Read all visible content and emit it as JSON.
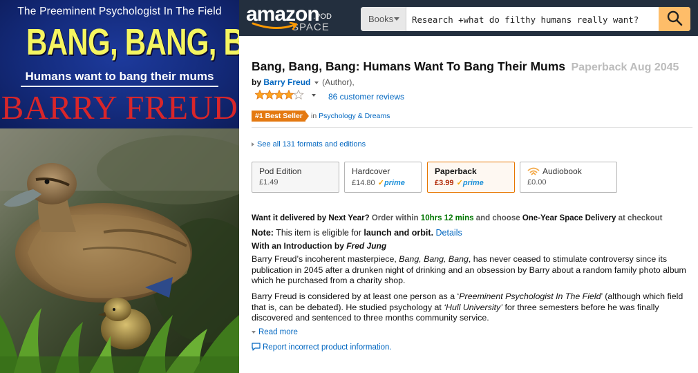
{
  "cover": {
    "tagline": "The Preeminent Psychologist In The Field",
    "title": "BANG, BANG, BANG",
    "subtitle": "Humans want to bang their mums",
    "author": "BARRY FREUD"
  },
  "header": {
    "logo_main": "amazon",
    "logo_pod": ".POD",
    "logo_space": "SPACE",
    "search_category": "Books",
    "search_value": "Research +what do filthy humans really want?",
    "search_icon": "magnifier-icon"
  },
  "product": {
    "title": "Bang, Bang, Bang: Humans Want To Bang Their Mums",
    "format_date": "Paperback Aug 2045",
    "by_label": "by",
    "author": "Barry Freud",
    "author_role": "(Author),",
    "rating_stars": 4,
    "rating_max": 5,
    "reviews": "86 customer reviews",
    "badge": "#1 Best Seller",
    "badge_in": "in",
    "badge_category": "Psychology & Dreams",
    "formats_link": "See all 131 formats and editions"
  },
  "formats": [
    {
      "name": "Pod Edition",
      "price": "£1.49",
      "prime": false
    },
    {
      "name": "Hardcover",
      "price": "£14.80",
      "prime": true
    },
    {
      "name": "Paperback",
      "price": "£3.99",
      "prime": true
    },
    {
      "name": "Audiobook",
      "price": "£0.00",
      "prime": false
    }
  ],
  "prime_label": "prime",
  "delivery": {
    "q": "Want it delivered by Next Year?",
    "order": "Order within",
    "time": "10hrs 12 mins",
    "choose": "and choose",
    "option": "One-Year Space Delivery",
    "at": "at checkout"
  },
  "note": {
    "label": "Note:",
    "text": "This item is eligible for",
    "bold": "launch and orbit.",
    "link": "Details"
  },
  "intro": {
    "prefix": "With an Introduction by",
    "name": "Fred Jung"
  },
  "description": {
    "p1_a": "Barry Freud’s incoherent masterpiece,",
    "p1_title": "Bang, Bang, Bang",
    "p1_b": ", has never ceased to stimulate controversy since its publication in 2045 after a drunken night of drinking and an obsession by Barry about a random family photo album which he purchased from a charity shop.",
    "p2_a": "Barry Freud is considered by at least one person as a ‘",
    "p2_i1": "Preeminent Psychologist In The Field",
    "p2_b": "’ (although which field that is, can be debated). He studied psychology at",
    "p2_i2": "‘Hull University’",
    "p2_c": "for three semesters before he was finally discovered and sentenced to three months community service."
  },
  "read_more": "Read more",
  "report": "Report incorrect product information.",
  "colors": {
    "header_bg": "#232f3e",
    "link": "#0066c0",
    "badge": "#e47911",
    "price": "#b12704",
    "search_btn": "#febd69"
  }
}
